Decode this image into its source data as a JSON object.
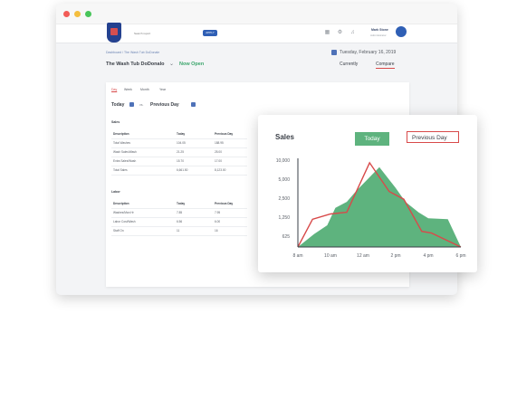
{
  "window": {
    "controls": [
      "close",
      "minimize",
      "maximize"
    ]
  },
  "header": {
    "search_placeholder": "Search report",
    "apply_label": "APPLY",
    "icons": [
      "chart-icon",
      "gear-icon",
      "bell-icon"
    ],
    "user_name": "Mark Stone",
    "user_role": "Administrator"
  },
  "subheader": {
    "breadcrumb": "Dashboard / The Wash Tub DoDonale",
    "store_name": "The Wash Tub DoDonalo",
    "store_status": "Now Open",
    "date": "Tuesday, February 16, 2019",
    "tabs": {
      "currently": "Currently",
      "compare": "Compare"
    }
  },
  "report": {
    "period_tabs": [
      "Day",
      "Week",
      "Month",
      "Year"
    ],
    "compare": {
      "left": "Today",
      "vs": "vs.",
      "right": "Previous Day"
    },
    "sales_section": "Sales",
    "sales_columns": [
      "Description",
      "Today",
      "Previous Day"
    ],
    "sales_rows": [
      [
        "Total Washes",
        "104.05",
        "188.95"
      ],
      [
        "Wash Sales/Wash",
        "21.25",
        "25.00"
      ],
      [
        "Extra Sales/Wash",
        "15.70",
        "17.00"
      ],
      [
        "Total Sales",
        "6,661.50",
        "8,123.00"
      ]
    ],
    "labor_section": "Labor",
    "labor_columns": [
      "Description",
      "Today",
      "Previous Day"
    ],
    "labor_rows": [
      [
        "Washes/Man Hr",
        "7.85",
        "7.95"
      ],
      [
        "Labor Cost/Wash",
        "6.56",
        "6.00"
      ],
      [
        "Staff On",
        "11",
        "16"
      ]
    ],
    "mini_sales_label": "Sales"
  },
  "popup": {
    "title": "Sales",
    "today_label": "Today",
    "prev_label": "Previous Day",
    "colors": {
      "today": "#5eb37e",
      "previous": "#d84a4a"
    }
  },
  "chart_data": {
    "type": "area",
    "title": "Sales",
    "x": [
      "8 am",
      "10 am",
      "12 am",
      "2 pm",
      "4 pm",
      "6 pm"
    ],
    "y_ticks": [
      "625",
      "1,250",
      "2,500",
      "5,000",
      "10,000"
    ],
    "series": [
      {
        "name": "Today",
        "style": "area",
        "points": [
          [
            0,
            0
          ],
          [
            0.5,
            0.15
          ],
          [
            0.9,
            0.25
          ],
          [
            1.15,
            0.45
          ],
          [
            1.5,
            0.52
          ],
          [
            1.8,
            0.65
          ],
          [
            2.5,
            0.92
          ],
          [
            3.0,
            0.68
          ],
          [
            3.3,
            0.52
          ],
          [
            3.7,
            0.4
          ],
          [
            4.0,
            0.33
          ],
          [
            4.6,
            0.32
          ],
          [
            5.0,
            0.0
          ]
        ]
      },
      {
        "name": "Previous Day",
        "style": "line",
        "points": [
          [
            0,
            0
          ],
          [
            0.45,
            0.32
          ],
          [
            1.0,
            0.38
          ],
          [
            1.5,
            0.4
          ],
          [
            2.2,
            0.97
          ],
          [
            2.8,
            0.64
          ],
          [
            3.25,
            0.55
          ],
          [
            3.8,
            0.18
          ],
          [
            4.1,
            0.16
          ],
          [
            5.0,
            0.0
          ]
        ]
      }
    ]
  }
}
